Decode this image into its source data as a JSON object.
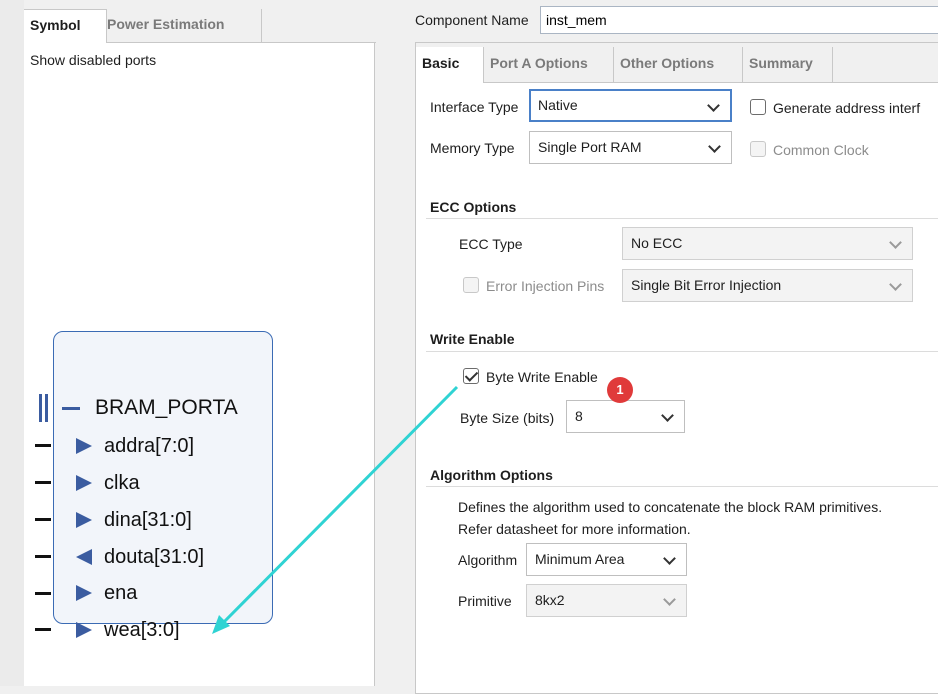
{
  "left_tabs": {
    "symbol": "Symbol",
    "power": "Power Estimation"
  },
  "show_disabled_ports": "Show disabled ports",
  "bram": {
    "title": "BRAM_PORTA",
    "ports": [
      {
        "name": "addra[7:0]",
        "direction": "in"
      },
      {
        "name": "clka",
        "direction": "in"
      },
      {
        "name": "dina[31:0]",
        "direction": "in"
      },
      {
        "name": "douta[31:0]",
        "direction": "out"
      },
      {
        "name": "ena",
        "direction": "in"
      },
      {
        "name": "wea[3:0]",
        "direction": "in"
      }
    ]
  },
  "component": {
    "label": "Component Name",
    "value": "inst_mem"
  },
  "right_tabs": {
    "basic": "Basic",
    "port_a": "Port A Options",
    "other": "Other Options",
    "summary": "Summary"
  },
  "basic": {
    "interface_type_label": "Interface Type",
    "interface_type_value": "Native",
    "generate_address_label": "Generate address interf",
    "memory_type_label": "Memory Type",
    "memory_type_value": "Single Port RAM",
    "common_clock_label": "Common Clock"
  },
  "ecc": {
    "title": "ECC Options",
    "type_label": "ECC Type",
    "type_value": "No ECC",
    "error_injection_label": "Error Injection Pins",
    "error_injection_value": "Single Bit Error Injection"
  },
  "write_enable": {
    "title": "Write Enable",
    "byte_write_label": "Byte Write Enable",
    "byte_write_checked": true,
    "byte_size_label": "Byte Size (bits)",
    "byte_size_value": "8",
    "badge": "1"
  },
  "algorithm": {
    "title": "Algorithm Options",
    "desc_line1": "Defines the algorithm used to concatenate the block RAM primitives.",
    "desc_line2": "Refer datasheet for more information.",
    "algorithm_label": "Algorithm",
    "algorithm_value": "Minimum Area",
    "primitive_label": "Primitive",
    "primitive_value": "8kx2"
  },
  "colors": {
    "accent_blue": "#4a80c8",
    "port_blue": "#3b5ca0",
    "badge_red": "#e03a3a",
    "pointer_cyan": "#2fd3d3"
  }
}
